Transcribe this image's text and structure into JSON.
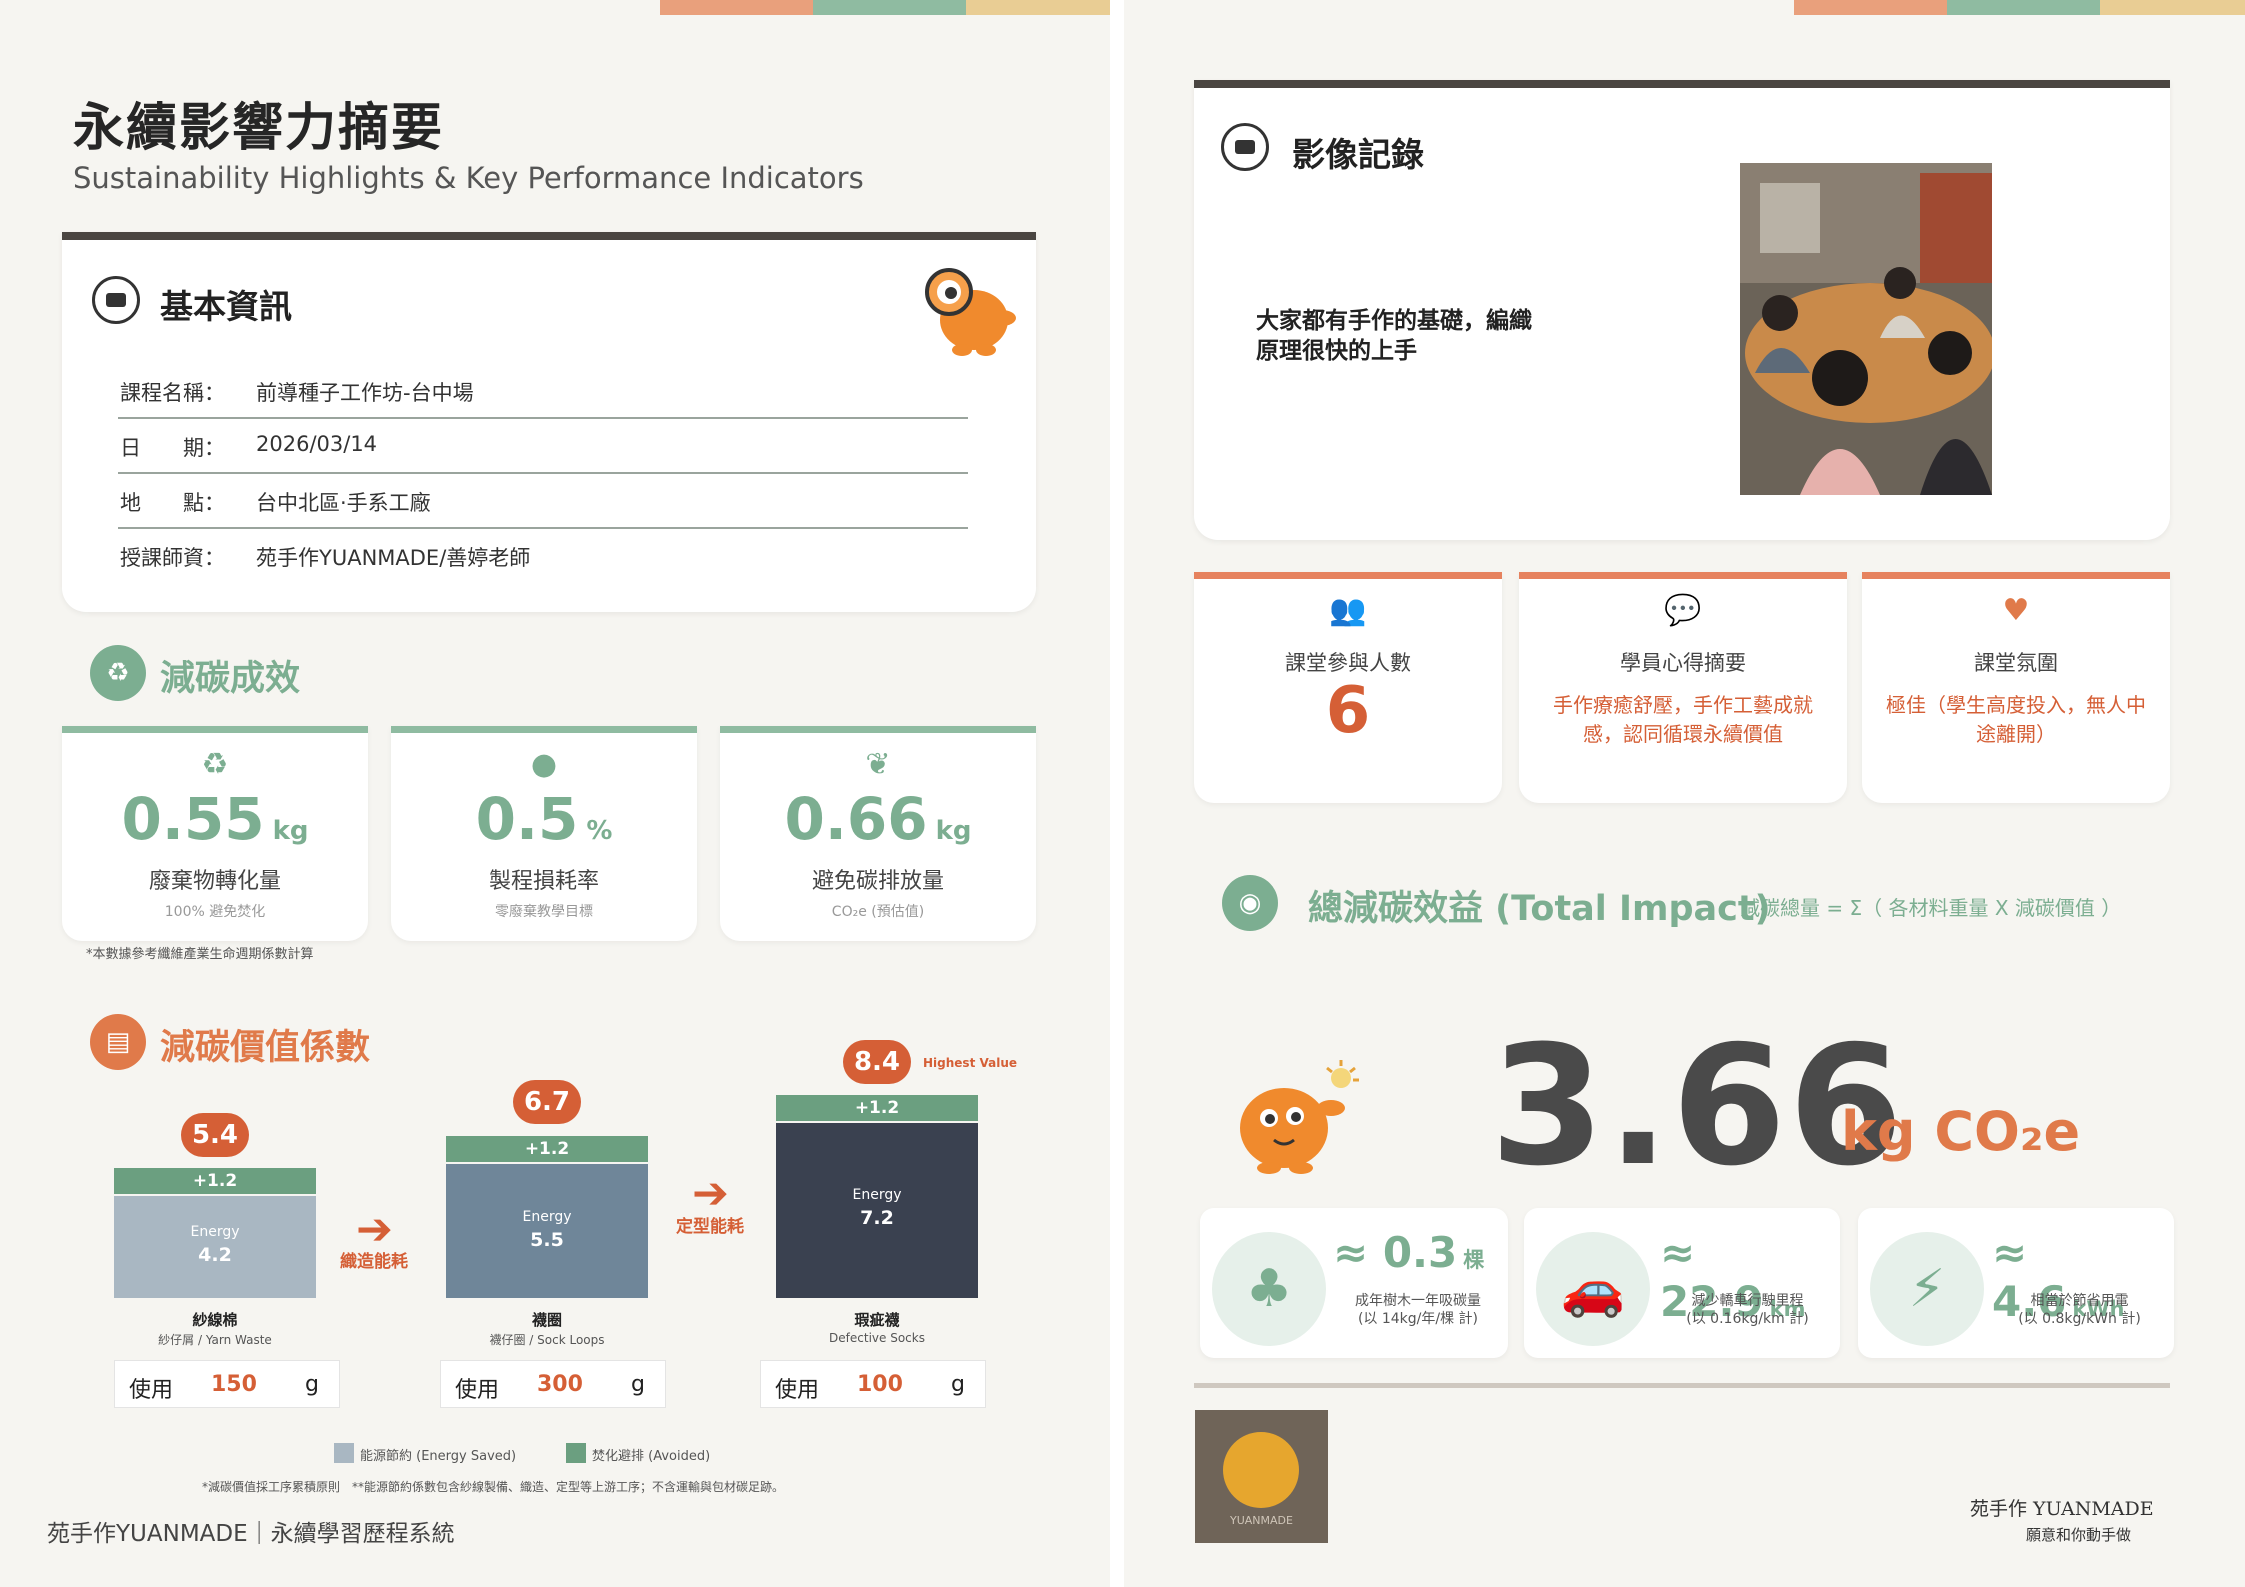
{
  "left": {
    "title": "永續影響力摘要",
    "subtitle": "Sustainability Highlights & Key Performance Indicators",
    "basic_info": {
      "title": "基本資訊",
      "rows": [
        {
          "k": "課程名稱：",
          "v": "前導種子工作坊-台中場"
        },
        {
          "k": "日　　期：",
          "v": "2026/03/14"
        },
        {
          "k": "地　　點：",
          "v": "台中北區·手系工廠"
        },
        {
          "k": "授課師資：",
          "v": "苑手作YUANMADE/善婷老師"
        }
      ]
    },
    "carbon": {
      "title": "減碳成效",
      "stats": [
        {
          "icon": "♻",
          "value": "0.55",
          "unit": "kg",
          "label": "廢棄物轉化量",
          "sub": "100% 避免焚化"
        },
        {
          "icon": "●",
          "value": "0.5",
          "unit": "%",
          "label": "製程損耗率",
          "sub": "零廢棄教學目標"
        },
        {
          "icon": "❦",
          "value": "0.66",
          "unit": "kg",
          "label": "避免碳排放量",
          "sub": "CO₂e (預估值)"
        }
      ],
      "note": "*本數據參考纖維產業生命週期係數計算"
    },
    "coeff": {
      "title": "減碳價值係數",
      "highest_tag": "Highest Value",
      "bars": [
        {
          "total": "5.4",
          "avoided": "+1.2",
          "energy_label": "Energy",
          "energy": "4.2",
          "name": "紗線棉",
          "sub": "紗仔屑 / Yarn Waste",
          "use_label": "使用",
          "use": "150",
          "unit": "g"
        },
        {
          "total": "6.7",
          "avoided": "+1.2",
          "energy_label": "Energy",
          "energy": "5.5",
          "name": "襪圈",
          "sub": "襪仔圈 / Sock Loops",
          "use_label": "使用",
          "use": "300",
          "unit": "g"
        },
        {
          "total": "8.4",
          "avoided": "+1.2",
          "energy_label": "Energy",
          "energy": "7.2",
          "name": "瑕疵襪",
          "sub": "Defective Socks",
          "use_label": "使用",
          "use": "100",
          "unit": "g"
        }
      ],
      "arrows": [
        "織造能耗",
        "定型能耗"
      ],
      "legend": [
        {
          "label": "能源節約 (Energy Saved)",
          "color": "#a9b7c2"
        },
        {
          "label": "焚化避排 (Avoided)",
          "color": "#6b9f80"
        }
      ],
      "footnote": "*減碳價值採工序累積原則　**能源節約係數包含紗線製備、織造、定型等上游工序；不含運輸與包材碳足跡。"
    },
    "footer": "苑手作YUANMADE｜永續學習歷程系統"
  },
  "right": {
    "photo": {
      "title": "影像記錄",
      "quote_line1": "大家都有手作的基礎，編織",
      "quote_line2": "原理很快的上手"
    },
    "kpis": [
      {
        "icon": "👥",
        "label": "課堂參與人數",
        "value": "6"
      },
      {
        "icon": "💬",
        "label": "學員心得摘要",
        "text": "手作療癒舒壓，手作工藝成就感，認同循環永續價值"
      },
      {
        "icon": "♥",
        "label": "課堂氛圍",
        "text": "極佳（學生高度投入，無人中途離開）"
      }
    ],
    "total": {
      "title": "總減碳效益 (Total Impact)",
      "formula": "減碳總量 = Σ（ 各材料重量 X 減碳價值 ）",
      "value": "3.66",
      "unit": "kg CO₂e"
    },
    "equivalents": [
      {
        "icon": "tree-icon",
        "glyph": "♣",
        "approx": "≈",
        "value": "0.3",
        "unit": "棵",
        "desc1": "成年樹木一年吸碳量",
        "desc2": "(以 14kg/年/棵 計)"
      },
      {
        "icon": "car-icon",
        "glyph": "🚗",
        "approx": "≈",
        "value": "22.9",
        "unit": "km",
        "desc1": "減少轎車行駛里程",
        "desc2": "(以 0.16kg/km 計)"
      },
      {
        "icon": "bolt-icon",
        "glyph": "⚡",
        "approx": "≈",
        "value": "4.6",
        "unit": "kWh",
        "desc1": "相當於節省用電",
        "desc2": "(以 0.8kg/kWh 計)"
      }
    ],
    "footer_logo": "YUANMADE",
    "footer_brand": "苑手作 YUANMADE",
    "footer_slogan": "願意和你動手做"
  },
  "colors": {
    "accent_orange": "#d55f36",
    "accent_green": "#7cae91",
    "dark": "#3a4150"
  }
}
